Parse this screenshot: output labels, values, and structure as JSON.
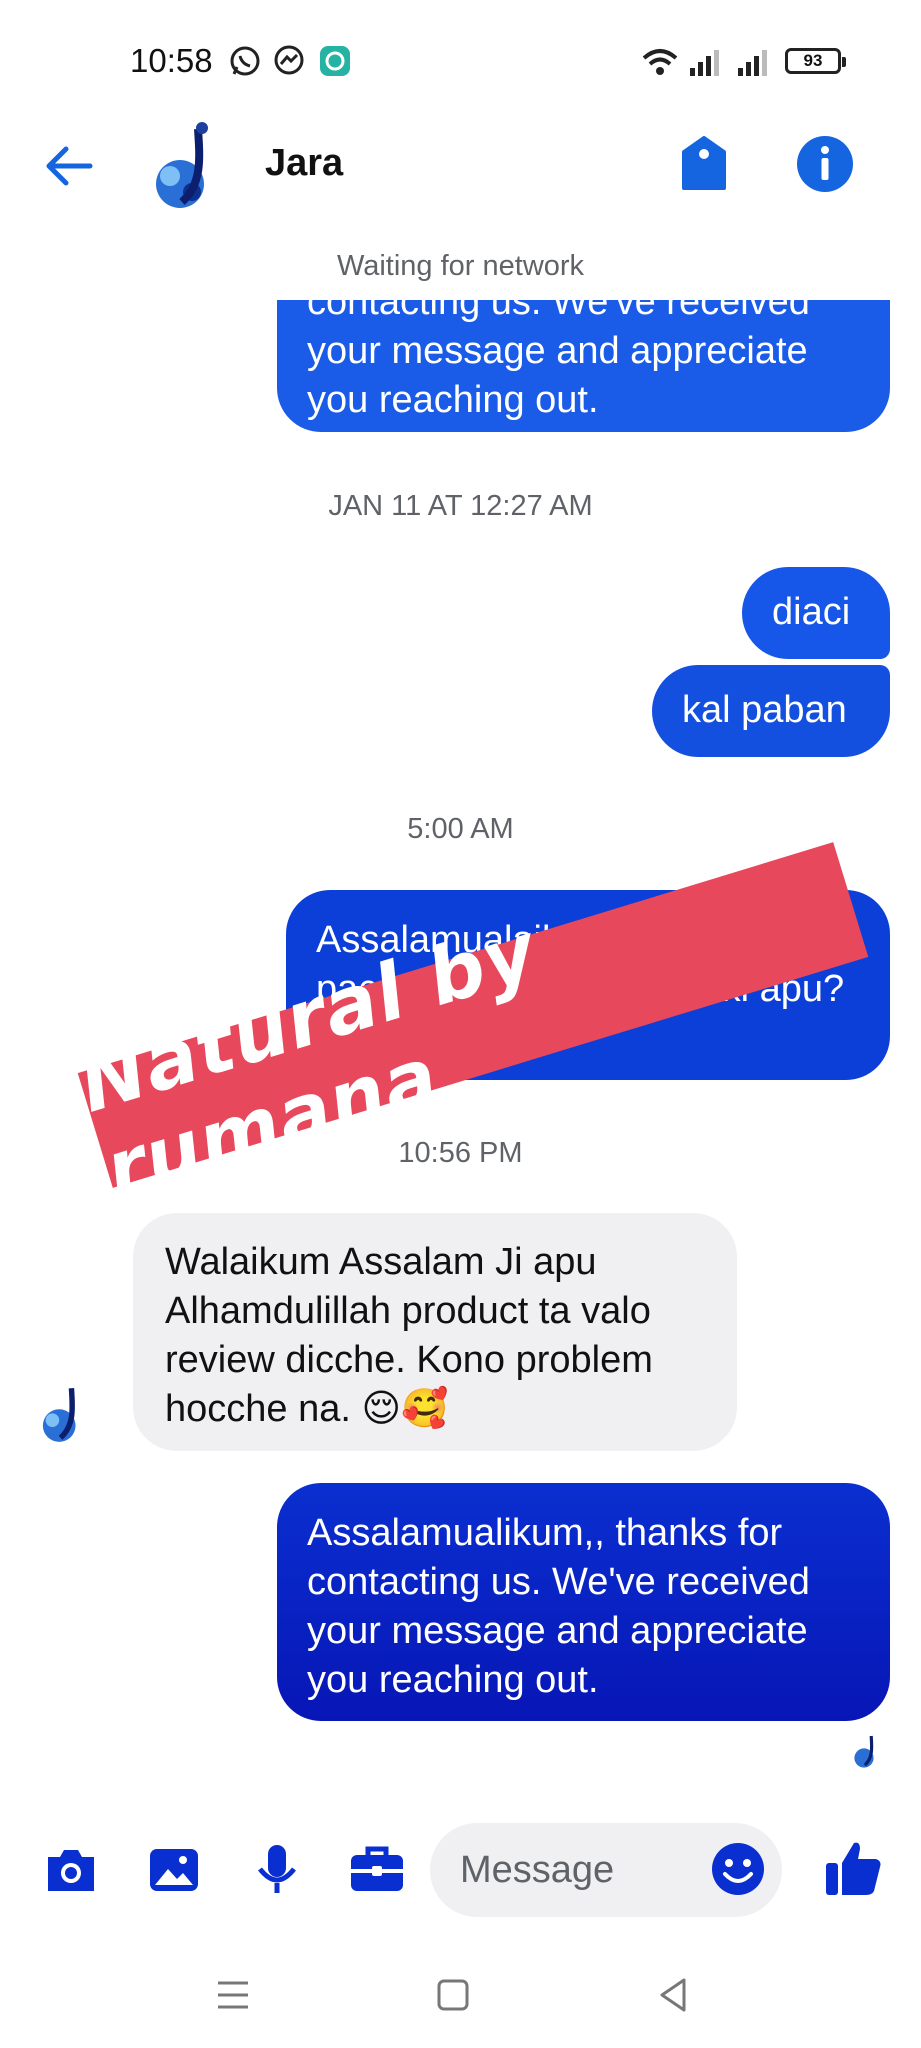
{
  "status_bar": {
    "time": "10:58",
    "battery": "93",
    "notification_icons": [
      "whatsapp-icon",
      "messenger-icon",
      "chat-app-icon"
    ],
    "system_icons": [
      "wifi-icon",
      "signal-icon",
      "signal-icon"
    ]
  },
  "header": {
    "contact_name": "Jara",
    "icons": [
      "back-arrow-icon",
      "tag-icon",
      "info-icon"
    ],
    "accent": "#1565e0"
  },
  "network_status": "Waiting for network",
  "messages": [
    {
      "type": "outgoing",
      "text": "contacting us. We've received your message and appreciate you reaching out."
    },
    {
      "type": "timestamp",
      "text": "JAN 11 AT 12:27 AM"
    },
    {
      "type": "outgoing",
      "text": "diaci"
    },
    {
      "type": "outgoing",
      "text": "kal paban"
    },
    {
      "type": "timestamp",
      "text": "5:00 AM"
    },
    {
      "type": "outgoing",
      "text": "Assalamualaikum product ta ki paccan? Kemon lagcca ki apu?"
    },
    {
      "type": "timestamp",
      "text": "10:56 PM"
    },
    {
      "type": "incoming",
      "text": "Walaikum Assalam Ji apu Alhamdulillah product ta valo review dicche. Kono problem hocche na. 😌🥰"
    },
    {
      "type": "outgoing",
      "text": "Assalamualikum,, thanks for contacting us. We've received your message and appreciate you reaching out."
    }
  ],
  "watermark": "Natural by rumana",
  "composer": {
    "placeholder": "Message",
    "icons": [
      "camera-icon",
      "gallery-icon",
      "microphone-icon",
      "briefcase-icon",
      "emoji-icon",
      "thumbs-up-icon"
    ]
  },
  "nav_bar": {
    "icons": [
      "menu-icon",
      "home-icon",
      "back-icon"
    ]
  }
}
